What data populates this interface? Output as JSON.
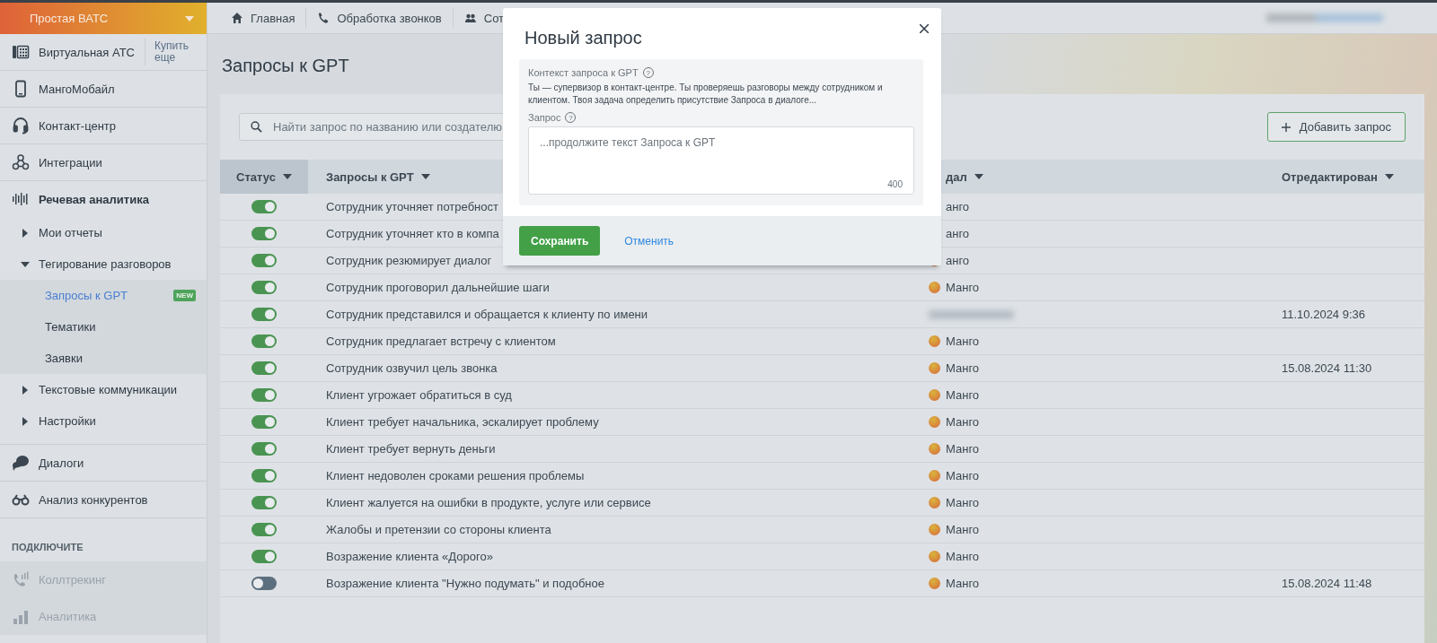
{
  "sidebar": {
    "brand": "Простая ВАТС",
    "items": [
      {
        "kind": "product",
        "label": "Виртуальная АТС",
        "link": "Купить еще"
      },
      {
        "kind": "product",
        "label": "МангоМобайл"
      },
      {
        "kind": "product",
        "label": "Контакт-центр"
      },
      {
        "kind": "product",
        "label": "Интеграции"
      },
      {
        "kind": "product",
        "label": "Речевая аналитика",
        "expanded": true,
        "children": [
          {
            "label": "Мои отчеты",
            "expanded": false
          },
          {
            "label": "Тегирование разговоров",
            "expanded": true,
            "children": [
              {
                "label": "Запросы к GPT",
                "selected": true,
                "badge": "NEW"
              },
              {
                "label": "Тематики",
                "selected": false
              },
              {
                "label": "Заявки",
                "selected": false
              }
            ]
          },
          {
            "label": "Текстовые коммуникации",
            "expanded": false
          },
          {
            "label": "Настройки",
            "expanded": false
          }
        ]
      },
      {
        "kind": "product",
        "label": "Диалоги"
      },
      {
        "kind": "product",
        "label": "Анализ конкурентов"
      },
      {
        "kind": "heading",
        "label": "ПОДКЛЮЧИТЕ"
      },
      {
        "kind": "offer",
        "label": "Коллтрекинг",
        "disabled": true
      },
      {
        "kind": "offer",
        "label": "Аналитика",
        "disabled": true
      }
    ]
  },
  "top_nav": [
    {
      "label": "Главная"
    },
    {
      "label": "Обработка звонков"
    },
    {
      "label": "Сот"
    }
  ],
  "page_title": "Запросы к GPT",
  "search": {
    "placeholder": "Найти запрос по названию или создателю"
  },
  "add_button": "Добавить запрос",
  "table": {
    "columns": [
      {
        "label": "Статус",
        "selected": true
      },
      {
        "label": "Запросы к GPT",
        "selected": false
      },
      {
        "label": "дал",
        "selected": false
      },
      {
        "label": "Отредактирован",
        "selected": false
      }
    ],
    "rows": [
      {
        "on": true,
        "name": "Сотрудник уточняет потребност",
        "creator": {
          "name": "анго"
        }
      },
      {
        "on": true,
        "name": "Сотрудник уточняет кто в компа",
        "creator": {
          "name": "анго"
        }
      },
      {
        "on": true,
        "name": "Сотрудник резюмирует диалог",
        "creator": {
          "name": "анго"
        }
      },
      {
        "on": true,
        "name": "Сотрудник проговорил дальнейшие шаги",
        "creator": {
          "name": "Манго"
        }
      },
      {
        "on": true,
        "name": "Сотрудник представился и обращается к клиенту по имени",
        "creator": {
          "blurred": true
        },
        "edited": "11.10.2024 9:36"
      },
      {
        "on": true,
        "name": "Сотрудник предлагает встречу с клиентом",
        "creator": {
          "name": "Манго"
        }
      },
      {
        "on": true,
        "name": "Сотрудник озвучил цель звонка",
        "creator": {
          "name": "Манго"
        },
        "edited": "15.08.2024 11:30"
      },
      {
        "on": true,
        "name": "Клиент угрожает обратиться в суд",
        "creator": {
          "name": "Манго"
        }
      },
      {
        "on": true,
        "name": "Клиент требует начальника, эскалирует проблему",
        "creator": {
          "name": "Манго"
        }
      },
      {
        "on": true,
        "name": "Клиент требует вернуть деньги",
        "creator": {
          "name": "Манго"
        }
      },
      {
        "on": true,
        "name": "Клиент недоволен сроками решения проблемы",
        "creator": {
          "name": "Манго"
        }
      },
      {
        "on": true,
        "name": "Клиент жалуется на ошибки в продукте, услуге или сервисе",
        "creator": {
          "name": "Манго"
        }
      },
      {
        "on": true,
        "name": "Жалобы и претензии со стороны клиента",
        "creator": {
          "name": "Манго"
        }
      },
      {
        "on": true,
        "name": "Возражение клиента «Дорого»",
        "creator": {
          "name": "Манго"
        }
      },
      {
        "on": false,
        "name": "Возражение клиента \"Нужно подумать\" и подобное",
        "creator": {
          "name": "Манго"
        },
        "edited": "15.08.2024 11:48"
      }
    ]
  },
  "modal": {
    "title": "Новый запрос",
    "context_label": "Контекст запроса к GPT",
    "context_help": "?",
    "context_text": "Ты — супервизор в контакт-центре. Ты проверяешь разговоры между сотрудником и клиентом. Твоя задача определить присутствие Запроса в диалоге...",
    "query_label": "Запрос",
    "query_help": "?",
    "query_placeholder": "...продолжите текст Запроса к GPT",
    "counter": "400",
    "save": "Сохранить",
    "cancel": "Отменить"
  }
}
